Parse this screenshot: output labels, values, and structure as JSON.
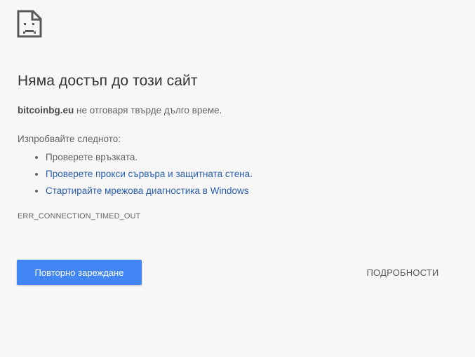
{
  "icon": {
    "name": "sad-document-icon"
  },
  "title": "Няма достъп до този сайт",
  "description": {
    "host": "bitcoinbg.eu",
    "text": " не отговаря твърде дълго време."
  },
  "suggestions": {
    "heading": "Изпробвайте следното:",
    "items": [
      {
        "label": "Проверете връзката.",
        "link": false
      },
      {
        "label": "Проверете прокси сървъра и защитната стена.",
        "link": true
      },
      {
        "label": "Стартирайте мрежова диагностика в Windows",
        "link": true
      }
    ]
  },
  "error_code": "ERR_CONNECTION_TIMED_OUT",
  "buttons": {
    "reload": "Повторно зареждане",
    "details": "ПОДРОБНОСТИ"
  },
  "colors": {
    "background": "#f7f7f7",
    "primary_button": "#4285f4",
    "link": "#2a5db0"
  }
}
